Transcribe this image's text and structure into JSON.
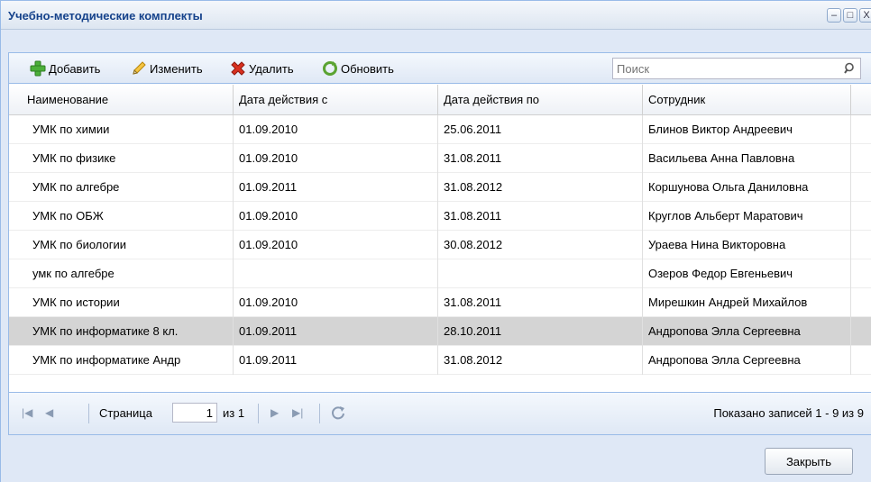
{
  "window": {
    "title": "Учебно-методические комплекты",
    "controls": {
      "minimize": "–",
      "maximize": "□",
      "close": "X"
    }
  },
  "toolbar": {
    "add_label": "Добавить",
    "edit_label": "Изменить",
    "delete_label": "Удалить",
    "refresh_label": "Обновить",
    "search_placeholder": "Поиск"
  },
  "grid": {
    "columns": [
      "Наименование",
      "Дата действия с",
      "Дата действия по",
      "Сотрудник"
    ],
    "rows": [
      [
        "УМК по химии",
        "01.09.2010",
        "25.06.2011",
        "Блинов Виктор Андреевич"
      ],
      [
        "УМК по физике",
        "01.09.2010",
        "31.08.2011",
        "Васильева Анна Павловна"
      ],
      [
        "УМК по алгебре",
        "01.09.2011",
        "31.08.2012",
        "Коршунова Ольга Даниловна"
      ],
      [
        "УМК по ОБЖ",
        "01.09.2010",
        "31.08.2011",
        "Круглов Альберт Маратович"
      ],
      [
        "УМК по биологии",
        "01.09.2010",
        "30.08.2012",
        "Ураева Нина Викторовна"
      ],
      [
        "умк по алгебре",
        "",
        "",
        "Озеров Федор Евгеньевич"
      ],
      [
        "УМК по истории",
        "01.09.2010",
        "31.08.2011",
        "Мирешкин Андрей Михайлов"
      ],
      [
        "УМК по информатике 8 кл.",
        "01.09.2011",
        "28.10.2011",
        "Андропова Элла Сергеевна"
      ],
      [
        "УМК по информатике Андр",
        "01.09.2011",
        "31.08.2012",
        "Андропова Элла Сергеевна"
      ]
    ],
    "selected_row": 7
  },
  "pager": {
    "page_label": "Страница",
    "page_value": "1",
    "of_label": "из 1",
    "records_info": "Показано записей 1 - 9 из 9"
  },
  "footer": {
    "close_label": "Закрыть"
  },
  "colors": {
    "accent": "#99bbe8",
    "title_text": "#15428b",
    "selected_row": "#d4d4d4"
  }
}
